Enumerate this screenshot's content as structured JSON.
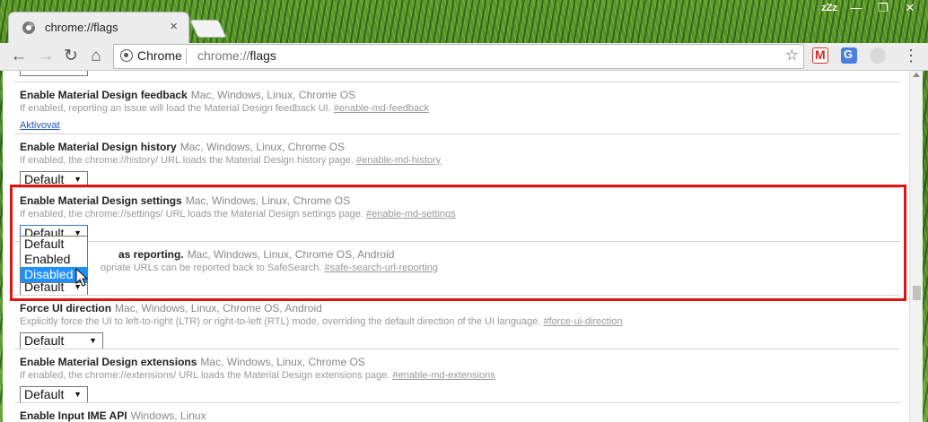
{
  "window": {
    "tab_title": "chrome://flags",
    "tab_close": "×",
    "controls": [
      "zZz",
      "—",
      "❐",
      "✕"
    ]
  },
  "toolbar": {
    "omnibox_chip": "Chrome",
    "omnibox_url_scheme": "chrome://",
    "omnibox_url_path": "flags"
  },
  "flags": [
    {
      "title": "Enable Material Design feedback",
      "platforms": "Mac, Windows, Linux, Chrome OS",
      "desc": "If enabled, reporting an issue will load the Material Design feedback UI.",
      "hash": "#enable-md-feedback",
      "control": "link",
      "control_text": "Aktivovat"
    },
    {
      "title": "Enable Material Design history",
      "platforms": "Mac, Windows, Linux, Chrome OS",
      "desc": "If enabled, the chrome://history/ URL loads the Material Design history page.",
      "hash": "#enable-md-history",
      "control": "select",
      "control_text": "Default"
    },
    {
      "title": "Enable Material Design settings",
      "platforms": "Mac, Windows, Linux, Chrome OS",
      "desc": "If enabled, the chrome://settings/ URL loads the Material Design settings page.",
      "hash": "#enable-md-settings",
      "control": "select",
      "control_text": "Default"
    },
    {
      "title": "as reporting.",
      "platforms": "Mac, Windows, Linux, Chrome OS, Android",
      "desc": "opriate URLs can be reported back to SafeSearch.",
      "hash": "#safe-search-url-reporting",
      "control": "select",
      "control_text": "Default"
    },
    {
      "title": "Force UI direction",
      "platforms": "Mac, Windows, Linux, Chrome OS, Android",
      "desc": "Explicitly force the UI to left-to-right (LTR) or right-to-left (RTL) mode, overriding the default direction of the UI language.",
      "hash": "#force-ui-direction",
      "control": "select",
      "control_text": "Default"
    },
    {
      "title": "Enable Material Design extensions",
      "platforms": "Mac, Windows, Linux, Chrome OS",
      "desc": "If enabled, the chrome://extensions/ URL loads the Material Design extensions page.",
      "hash": "#enable-md-extensions",
      "control": "select",
      "control_text": "Default"
    },
    {
      "title": "Enable Input IME API",
      "platforms": "Windows, Linux",
      "desc": "",
      "hash": "",
      "control": "none",
      "control_text": ""
    }
  ],
  "dropdown": {
    "options": [
      "Default",
      "Enabled",
      "Disabled"
    ],
    "highlighted": "Disabled"
  },
  "colors": {
    "highlight_border": "#e01414",
    "selection": "#1e90ff",
    "link": "#1a53c9"
  },
  "icons": [
    "chrome-favicon",
    "back-icon",
    "forward-icon",
    "reload-icon",
    "home-icon",
    "info-icon",
    "star-icon",
    "gmail-icon",
    "translate-icon",
    "extension-icon",
    "menu-icon",
    "cursor-icon"
  ]
}
